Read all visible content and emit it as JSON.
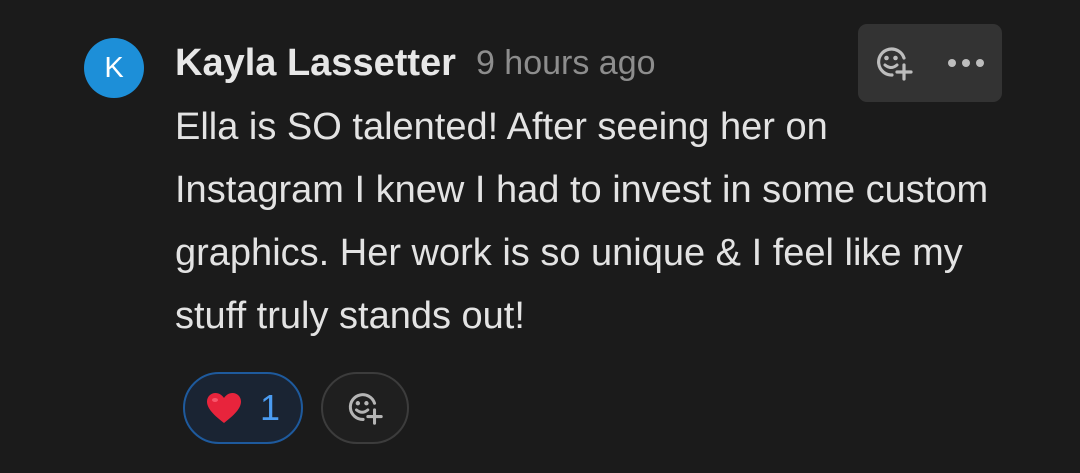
{
  "comment": {
    "avatar_initial": "K",
    "author": "Kayla Lassetter",
    "timestamp": "9 hours ago",
    "body": "Ella is SO talented! After seeing her on Instagram I knew I had to invest in some custom graphics. Her work is so unique & I feel like my stuff truly stands out!"
  },
  "reactions": [
    {
      "icon": "heart-icon",
      "count": "1",
      "selected": true
    }
  ],
  "icons": {
    "add_reaction": "add-reaction-icon",
    "more": "more-options-icon"
  },
  "colors": {
    "background": "#1b1b1b",
    "avatar": "#1d8fd8",
    "reaction_accent": "#4b9cf2",
    "heart": "#e8243c"
  }
}
